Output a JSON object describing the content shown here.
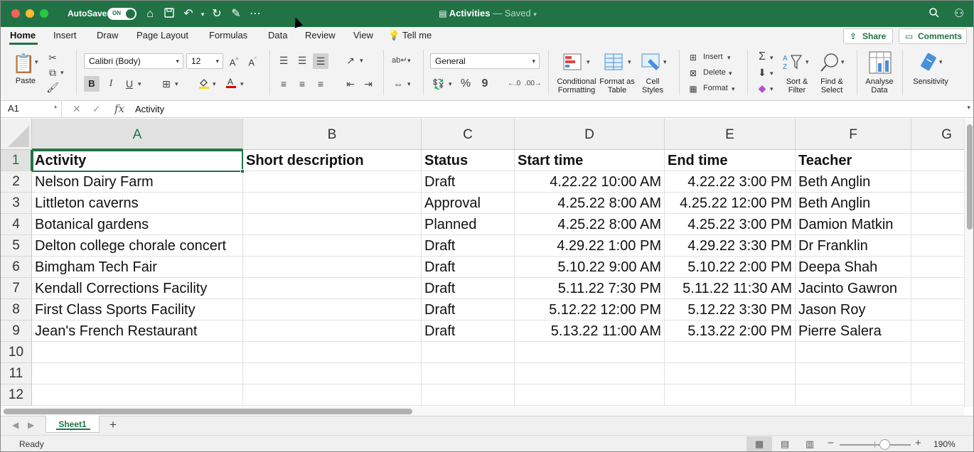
{
  "titlebar": {
    "autosave_label": "AutoSave",
    "autosave_state": "ON",
    "title": "Activities",
    "saved_state": "— Saved"
  },
  "tabs": [
    "Home",
    "Insert",
    "Draw",
    "Page Layout",
    "Formulas",
    "Data",
    "Review",
    "View",
    "Tell me"
  ],
  "share_label": "Share",
  "comments_label": "Comments",
  "ribbon": {
    "paste_label": "Paste",
    "font_name": "Calibri (Body)",
    "font_size": "12",
    "grow_font": "A^",
    "shrink_font": "Aˇ",
    "bold": "B",
    "italic": "I",
    "underline": "U",
    "number_format": "General",
    "percent": "%",
    "comma": "9",
    "conditional_formatting": "Conditional Formatting",
    "format_as_table": "Format as Table",
    "cell_styles": "Cell Styles",
    "insert": "Insert",
    "delete": "Delete",
    "format": "Format",
    "sort_filter": "Sort & Filter",
    "find_select": "Find & Select",
    "analyse_data": "Analyse Data",
    "sensitivity": "Sensitivity"
  },
  "formula_bar": {
    "name_box": "A1",
    "fx": "fx",
    "value": "Activity"
  },
  "grid": {
    "columns": [
      "A",
      "B",
      "C",
      "D",
      "E",
      "F",
      "G"
    ],
    "rows": [
      "1",
      "2",
      "3",
      "4",
      "5",
      "6",
      "7",
      "8",
      "9",
      "10",
      "11",
      "12"
    ],
    "cells": [
      [
        "Activity",
        "Short description",
        "Status",
        "Start time",
        "End time",
        "Teacher"
      ],
      [
        "Nelson Dairy Farm",
        "",
        "Draft",
        "4.22.22 10:00 AM",
        "4.22.22 3:00 PM",
        "Beth Anglin"
      ],
      [
        "Littleton caverns",
        "",
        "Approval",
        "4.25.22 8:00 AM",
        "4.25.22 12:00 PM",
        "Beth Anglin"
      ],
      [
        "Botanical gardens",
        "",
        "Planned",
        "4.25.22 8:00 AM",
        "4.25.22 3:00 PM",
        "Damion Matkin"
      ],
      [
        "Delton college chorale concert",
        "",
        "Draft",
        "4.29.22 1:00 PM",
        "4.29.22 3:30 PM",
        "Dr Franklin"
      ],
      [
        "Bimgham Tech Fair",
        "",
        "Draft",
        "5.10.22 9:00 AM",
        "5.10.22 2:00 PM",
        "Deepa Shah"
      ],
      [
        "Kendall Corrections Facility",
        "",
        "Draft",
        "5.11.22 7:30 PM",
        "5.11.22 11:30 AM",
        "Jacinto Gawron"
      ],
      [
        "First Class Sports Facility",
        "",
        "Draft",
        "5.12.22 12:00 PM",
        "5.12.22 3:30 PM",
        "Jason Roy"
      ],
      [
        "Jean's French Restaurant",
        "",
        "Draft",
        "5.13.22 11:00 AM",
        "5.13.22 2:00 PM",
        "Pierre Salera"
      ]
    ]
  },
  "sheet_tab": "Sheet1",
  "status": {
    "ready": "Ready",
    "zoom": "190%"
  }
}
